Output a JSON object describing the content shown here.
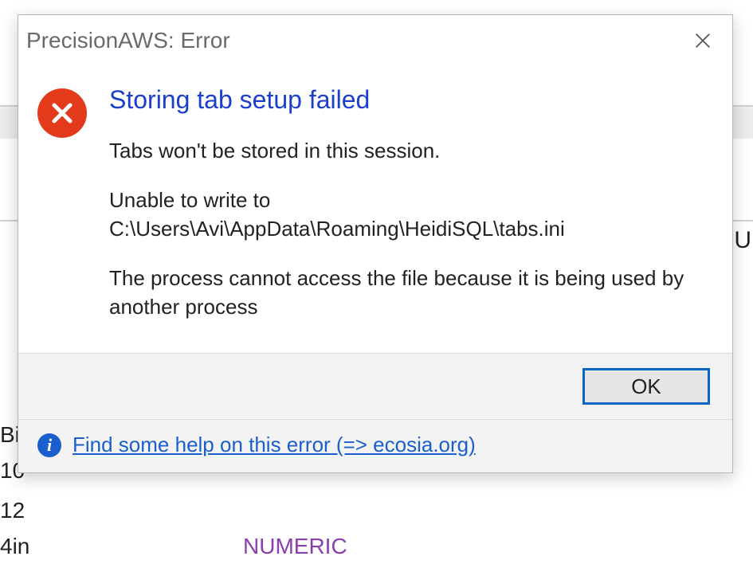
{
  "background": {
    "u": "U",
    "bi": "Bi",
    "n10": "10",
    "n12": "12",
    "n4in": "4in",
    "numeric": "NUMERIC"
  },
  "dialog": {
    "title": "PrecisionAWS: Error",
    "headline": "Storing tab setup failed",
    "line1": "Tabs won't be stored in this session.",
    "line2a": "Unable to write to",
    "line2b": "C:\\Users\\Avi\\AppData\\Roaming\\HeidiSQL\\tabs.ini",
    "line3": "The process cannot access the file because it is being used by another process",
    "ok_label": "OK",
    "help_link": "Find some help on this error (=> ecosia.org)"
  }
}
